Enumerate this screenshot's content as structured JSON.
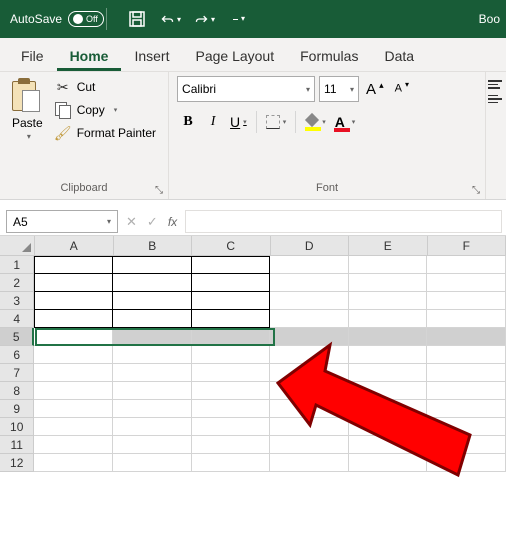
{
  "title_bar": {
    "autosave_label": "AutoSave",
    "autosave_state": "Off",
    "doc_name": "Boo"
  },
  "tabs": {
    "file": "File",
    "home": "Home",
    "insert": "Insert",
    "page_layout": "Page Layout",
    "formulas": "Formulas",
    "data": "Data"
  },
  "clipboard": {
    "paste": "Paste",
    "cut": "Cut",
    "copy": "Copy",
    "format_painter": "Format Painter",
    "group_label": "Clipboard"
  },
  "font": {
    "name": "Calibri",
    "size": "11",
    "increase": "A",
    "decrease": "A",
    "bold": "B",
    "italic": "I",
    "underline": "U",
    "color_char": "A",
    "group_label": "Font"
  },
  "formula_bar": {
    "name_box": "A5",
    "fx": "fx"
  },
  "grid": {
    "columns": [
      "A",
      "B",
      "C",
      "D",
      "E",
      "F"
    ],
    "rows": [
      "1",
      "2",
      "3",
      "4",
      "5",
      "6",
      "7",
      "8",
      "9",
      "10",
      "11",
      "12"
    ],
    "selected_row": 5,
    "bordered_range": {
      "r1": 1,
      "r2": 4,
      "c1": 1,
      "c2": 3
    }
  }
}
